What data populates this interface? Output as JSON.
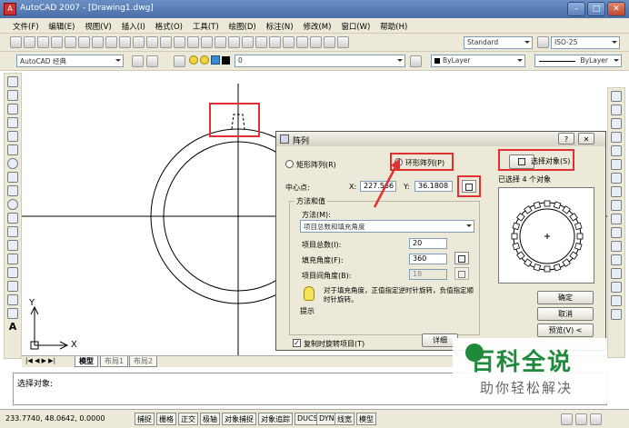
{
  "window": {
    "title": "AutoCAD 2007 - [Drawing1.dwg]"
  },
  "menubar": {
    "items": [
      "文件(F)",
      "编辑(E)",
      "视图(V)",
      "插入(I)",
      "格式(O)",
      "工具(T)",
      "绘图(D)",
      "标注(N)",
      "修改(M)",
      "窗口(W)",
      "帮助(H)"
    ]
  },
  "toolbar": {
    "text_style": "Standard",
    "dim_style": "ISO-25",
    "workspace": "AutoCAD 经典",
    "layer": "0",
    "color": "ByLayer",
    "linetype": "ByLayer"
  },
  "canvas": {
    "axis_y": "Y",
    "axis_x": "X"
  },
  "layout_tabs": [
    "模型",
    "布局1",
    "布局2"
  ],
  "command": {
    "prompt": "选择对象:"
  },
  "status": {
    "coords": "233.7740, 48.0642, 0.0000",
    "toggles": [
      "捕捉",
      "栅格",
      "正交",
      "极轴",
      "对象捕捉",
      "对象追踪",
      "DUCS",
      "DYN",
      "线宽",
      "模型"
    ]
  },
  "dialog": {
    "title": "阵列",
    "help_button": "?",
    "rect_array": "矩形阵列(R)",
    "polar_array": "环形阵列(P)",
    "center_label": "中心点:",
    "x_label": "X:",
    "x_value": "227.566",
    "y_label": "Y:",
    "y_value": "36.1808",
    "method_group": "方法和值",
    "method_label": "方法(M):",
    "method_value": "项目总数和填充角度",
    "total_label": "项目总数(I):",
    "total_value": "20",
    "fill_label": "填充角度(F):",
    "fill_value": "360",
    "between_label": "项目间角度(B):",
    "between_value": "18",
    "tip_text": "对于填充角度，正值指定逆时针旋转，负值指定顺时针旋转。",
    "tip_label": "提示",
    "rotate_items": "复制时旋转项目(T)",
    "detail_button": "详细",
    "select_objects": "选择对象(S)",
    "selected_count": "已选择 4 个对象",
    "ok": "确定",
    "cancel": "取消",
    "preview": "预览(V) <"
  },
  "watermark": {
    "brand": "百科全说",
    "sub": "助你轻松解决"
  },
  "colors": {
    "highlight_red": "#e03030",
    "title_blue": "#4a6ea8",
    "watermark_green": "#1f8a3b"
  }
}
